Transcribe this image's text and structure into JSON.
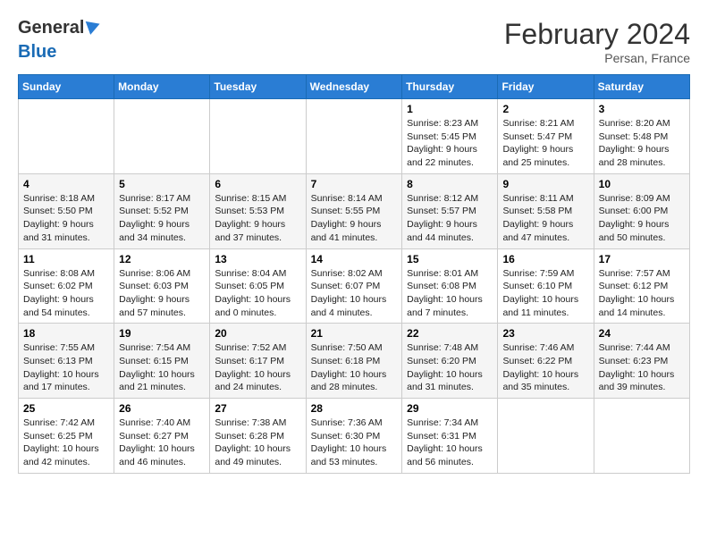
{
  "header": {
    "logo_general": "General",
    "logo_blue": "Blue",
    "month_year": "February 2024",
    "location": "Persan, France"
  },
  "weekdays": [
    "Sunday",
    "Monday",
    "Tuesday",
    "Wednesday",
    "Thursday",
    "Friday",
    "Saturday"
  ],
  "weeks": [
    [
      {
        "day": "",
        "info": ""
      },
      {
        "day": "",
        "info": ""
      },
      {
        "day": "",
        "info": ""
      },
      {
        "day": "",
        "info": ""
      },
      {
        "day": "1",
        "info": "Sunrise: 8:23 AM\nSunset: 5:45 PM\nDaylight: 9 hours\nand 22 minutes."
      },
      {
        "day": "2",
        "info": "Sunrise: 8:21 AM\nSunset: 5:47 PM\nDaylight: 9 hours\nand 25 minutes."
      },
      {
        "day": "3",
        "info": "Sunrise: 8:20 AM\nSunset: 5:48 PM\nDaylight: 9 hours\nand 28 minutes."
      }
    ],
    [
      {
        "day": "4",
        "info": "Sunrise: 8:18 AM\nSunset: 5:50 PM\nDaylight: 9 hours\nand 31 minutes."
      },
      {
        "day": "5",
        "info": "Sunrise: 8:17 AM\nSunset: 5:52 PM\nDaylight: 9 hours\nand 34 minutes."
      },
      {
        "day": "6",
        "info": "Sunrise: 8:15 AM\nSunset: 5:53 PM\nDaylight: 9 hours\nand 37 minutes."
      },
      {
        "day": "7",
        "info": "Sunrise: 8:14 AM\nSunset: 5:55 PM\nDaylight: 9 hours\nand 41 minutes."
      },
      {
        "day": "8",
        "info": "Sunrise: 8:12 AM\nSunset: 5:57 PM\nDaylight: 9 hours\nand 44 minutes."
      },
      {
        "day": "9",
        "info": "Sunrise: 8:11 AM\nSunset: 5:58 PM\nDaylight: 9 hours\nand 47 minutes."
      },
      {
        "day": "10",
        "info": "Sunrise: 8:09 AM\nSunset: 6:00 PM\nDaylight: 9 hours\nand 50 minutes."
      }
    ],
    [
      {
        "day": "11",
        "info": "Sunrise: 8:08 AM\nSunset: 6:02 PM\nDaylight: 9 hours\nand 54 minutes."
      },
      {
        "day": "12",
        "info": "Sunrise: 8:06 AM\nSunset: 6:03 PM\nDaylight: 9 hours\nand 57 minutes."
      },
      {
        "day": "13",
        "info": "Sunrise: 8:04 AM\nSunset: 6:05 PM\nDaylight: 10 hours\nand 0 minutes."
      },
      {
        "day": "14",
        "info": "Sunrise: 8:02 AM\nSunset: 6:07 PM\nDaylight: 10 hours\nand 4 minutes."
      },
      {
        "day": "15",
        "info": "Sunrise: 8:01 AM\nSunset: 6:08 PM\nDaylight: 10 hours\nand 7 minutes."
      },
      {
        "day": "16",
        "info": "Sunrise: 7:59 AM\nSunset: 6:10 PM\nDaylight: 10 hours\nand 11 minutes."
      },
      {
        "day": "17",
        "info": "Sunrise: 7:57 AM\nSunset: 6:12 PM\nDaylight: 10 hours\nand 14 minutes."
      }
    ],
    [
      {
        "day": "18",
        "info": "Sunrise: 7:55 AM\nSunset: 6:13 PM\nDaylight: 10 hours\nand 17 minutes."
      },
      {
        "day": "19",
        "info": "Sunrise: 7:54 AM\nSunset: 6:15 PM\nDaylight: 10 hours\nand 21 minutes."
      },
      {
        "day": "20",
        "info": "Sunrise: 7:52 AM\nSunset: 6:17 PM\nDaylight: 10 hours\nand 24 minutes."
      },
      {
        "day": "21",
        "info": "Sunrise: 7:50 AM\nSunset: 6:18 PM\nDaylight: 10 hours\nand 28 minutes."
      },
      {
        "day": "22",
        "info": "Sunrise: 7:48 AM\nSunset: 6:20 PM\nDaylight: 10 hours\nand 31 minutes."
      },
      {
        "day": "23",
        "info": "Sunrise: 7:46 AM\nSunset: 6:22 PM\nDaylight: 10 hours\nand 35 minutes."
      },
      {
        "day": "24",
        "info": "Sunrise: 7:44 AM\nSunset: 6:23 PM\nDaylight: 10 hours\nand 39 minutes."
      }
    ],
    [
      {
        "day": "25",
        "info": "Sunrise: 7:42 AM\nSunset: 6:25 PM\nDaylight: 10 hours\nand 42 minutes."
      },
      {
        "day": "26",
        "info": "Sunrise: 7:40 AM\nSunset: 6:27 PM\nDaylight: 10 hours\nand 46 minutes."
      },
      {
        "day": "27",
        "info": "Sunrise: 7:38 AM\nSunset: 6:28 PM\nDaylight: 10 hours\nand 49 minutes."
      },
      {
        "day": "28",
        "info": "Sunrise: 7:36 AM\nSunset: 6:30 PM\nDaylight: 10 hours\nand 53 minutes."
      },
      {
        "day": "29",
        "info": "Sunrise: 7:34 AM\nSunset: 6:31 PM\nDaylight: 10 hours\nand 56 minutes."
      },
      {
        "day": "",
        "info": ""
      },
      {
        "day": "",
        "info": ""
      }
    ]
  ]
}
